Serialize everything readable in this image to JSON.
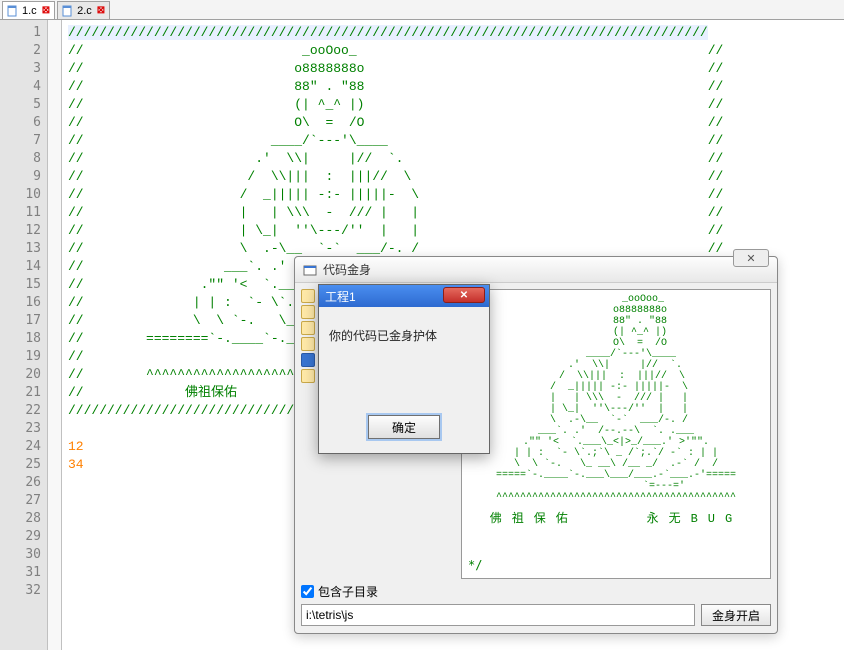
{
  "tabs": [
    {
      "label": "1.c",
      "active": true
    },
    {
      "label": "2.c",
      "active": false
    }
  ],
  "gutter_start": 1,
  "gutter_end": 32,
  "code_lines": [
    "//////////////////////////////////////////////////////////////////////////////////",
    "//                            _ooOoo_                                             //",
    "//                           o8888888o                                            //",
    "//                           88\" . \"88                                            //",
    "//                           (| ^_^ |)                                            //",
    "//                           O\\  =  /O                                            //",
    "//                        ____/`---'\\____                                         //",
    "//                      .'  \\\\|     |//  `.                                       //",
    "//                     /  \\\\|||  :  |||//  \\                                      //",
    "//                    /  _||||| -:- |||||-  \\                                     //",
    "//                    |   | \\\\\\  -  /// |   |                                     //",
    "//                    | \\_|  ''\\---/''  |   |                                     //",
    "//                    \\  .-\\__  `-`  ___/-. /                                     //",
    "//                  ___`. .'  /--.--\\  `. . ___                                   //",
    "//               .\"\" '<  `.___\\_<|>_/___.'  >'\"\".                                //",
    "//              | | :  `- \\`.;`\\ _ /`;.`/ - ` : | |                              //",
    "//              \\  \\ `-.   \\_ __\\ /__ _/   .-` /  /                              //",
    "//        ========`-.____`-.___\\_____/___.-`____.-'========                     //",
    "//                              `=---='                                           //",
    "//        ^^^^^^^^^^^^^^^^^^^^^^^^^^^^^^^^^^^^^^^^^^^^^^^^^^                     //",
    "//             佛祖保佑                                                           //",
    "//////////////////////////////////////////////////////////////////////////////////"
  ],
  "code_tail": [
    "12",
    "34"
  ],
  "outer_window": {
    "title": "代码金身",
    "close_label": "✕",
    "checkbox_label": "包含子目录",
    "path_value": "i:\\tetris\\js",
    "action_button": "金身开启",
    "preview_caption_left": "佛祖保佑",
    "preview_caption_right": "永无BUG",
    "preview_art": "         _ooOoo_\n        o8888888o\n        88\" . \"88\n        (| ^_^ |)\n        O\\  =  /O\n     ____/`---'\\____\n   .'  \\\\|     |//  `.\n  /  \\\\|||  :  |||//  \\\n /  _||||| -:- |||||-  \\\n |   | \\\\\\  -  /// |   |\n | \\_|  ''\\---/''  |   |\n \\  .-\\__  `-`  ___/-. /\n___`. .'  /--.--\\  `. .___\n.\"\" '<  `.___\\_<|>_/___.' >'\"\".\n| | :  `- \\`.;`\\ _ /`;.`/ -` : | |\n\\  \\ `-.   \\_ __\\ /__ _/  .-` /  /\n=====`-.____`-.___\\___/___.-`___.-'=====\n                `=---='\n^^^^^^^^^^^^^^^^^^^^^^^^^^^^^^^^^^^^^^^^",
    "preview_end": "*/"
  },
  "modal": {
    "title": "工程1",
    "message": "你的代码已金身护体",
    "ok_label": "确定"
  }
}
